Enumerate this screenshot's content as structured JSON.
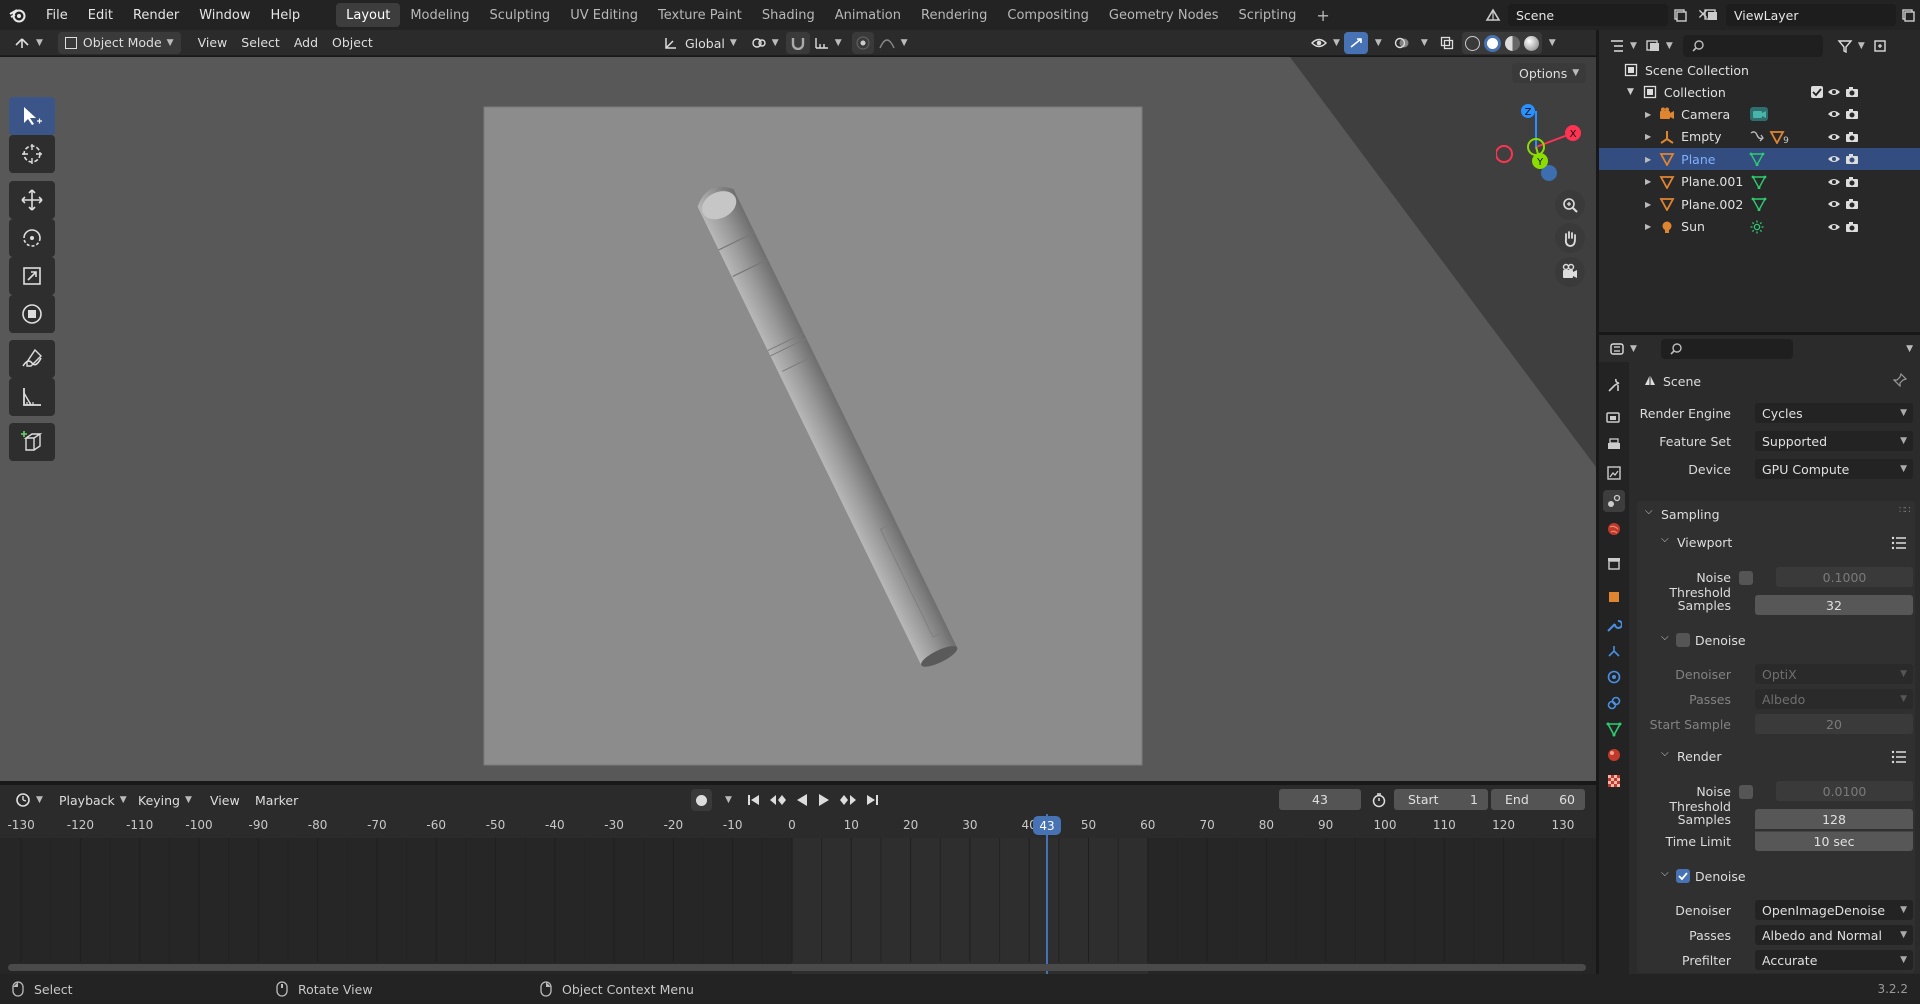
{
  "menus": [
    "File",
    "Edit",
    "Render",
    "Window",
    "Help"
  ],
  "workspaces": [
    "Layout",
    "Modeling",
    "Sculpting",
    "UV Editing",
    "Texture Paint",
    "Shading",
    "Animation",
    "Rendering",
    "Compositing",
    "Geometry Nodes",
    "Scripting"
  ],
  "workspace_add": "+",
  "scene_name": "Scene",
  "view_layer": "ViewLayer",
  "viewport_header": {
    "mode": "Object Mode",
    "menus": [
      "View",
      "Select",
      "Add",
      "Object"
    ],
    "orientation": "Global"
  },
  "options_label": "Options",
  "gizmo": {
    "x": "X",
    "y": "Y",
    "z": "Z"
  },
  "timeline": {
    "menus": [
      "Playback",
      "Keying",
      "View",
      "Marker"
    ],
    "current_frame": "43",
    "start_label": "Start",
    "start_value": "1",
    "end_label": "End",
    "end_value": "60",
    "ticks": [
      "-130",
      "-120",
      "-110",
      "-100",
      "-90",
      "-80",
      "-70",
      "-60",
      "-50",
      "-40",
      "-30",
      "-20",
      "-10",
      "0",
      "10",
      "20",
      "30",
      "40",
      "50",
      "60",
      "70",
      "80",
      "90",
      "100",
      "110",
      "120",
      "130"
    ],
    "playhead": "43"
  },
  "status": {
    "select": "Select",
    "rotate": "Rotate View",
    "context": "Object Context Menu",
    "version": "3.2.2"
  },
  "outliner": {
    "root": "Scene Collection",
    "collection": "Collection",
    "objects": [
      {
        "name": "Camera",
        "icon": "camera-icon",
        "data": "camera-data-icon",
        "selected": false
      },
      {
        "name": "Empty",
        "icon": "empty-icon",
        "data": "constraint-icon",
        "extra": "9",
        "selected": false
      },
      {
        "name": "Plane",
        "icon": "mesh-icon",
        "data": "mesh-data-icon",
        "selected": true
      },
      {
        "name": "Plane.001",
        "icon": "mesh-icon",
        "data": "mesh-data-icon",
        "selected": false
      },
      {
        "name": "Plane.002",
        "icon": "mesh-icon",
        "data": "mesh-data-icon",
        "selected": false
      },
      {
        "name": "Sun",
        "icon": "light-icon",
        "data": "sun-data-icon",
        "selected": false
      }
    ]
  },
  "properties": {
    "context": "Scene",
    "render_engine_label": "Render Engine",
    "render_engine": "Cycles",
    "feature_set_label": "Feature Set",
    "feature_set": "Supported",
    "device_label": "Device",
    "device": "GPU Compute",
    "sampling": "Sampling",
    "viewport": "Viewport",
    "vp_noise_label": "Noise Threshold",
    "vp_noise": "0.1000",
    "vp_samples_label": "Samples",
    "vp_samples": "32",
    "vp_denoise": "Denoise",
    "vp_denoiser_label": "Denoiser",
    "vp_denoiser": "OptiX",
    "vp_passes_label": "Passes",
    "vp_passes": "Albedo",
    "vp_start_label": "Start Sample",
    "vp_start": "20",
    "render": "Render",
    "r_noise_label": "Noise Threshold",
    "r_noise": "0.0100",
    "r_samples_label": "Samples",
    "r_samples": "128",
    "r_time_label": "Time Limit",
    "r_time": "10 sec",
    "r_denoise": "Denoise",
    "r_denoiser_label": "Denoiser",
    "r_denoiser": "OpenImageDenoise",
    "r_passes_label": "Passes",
    "r_passes": "Albedo and Normal",
    "r_prefilter_label": "Prefilter",
    "r_prefilter": "Accurate"
  }
}
